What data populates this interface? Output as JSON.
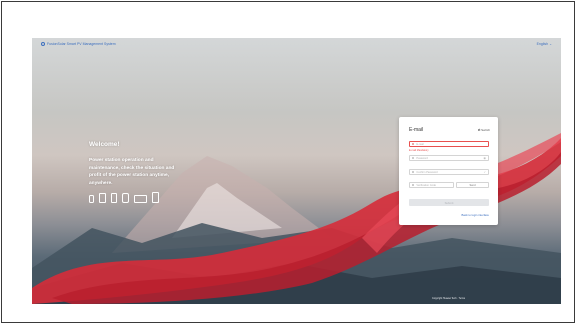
{
  "header": {
    "brand": "FusionSolar Smart PV Management System",
    "language": "English"
  },
  "hero": {
    "welcome": "Welcome!",
    "tagline": "Power station operation and maintenance, check the situation and profit of the power station anytime, anywhere."
  },
  "devices": [
    "mobile-icon",
    "tablet-icon",
    "phone-icon",
    "watch-icon",
    "laptop-icon",
    "tablet-alt-icon"
  ],
  "login": {
    "title": "E-mail",
    "switch_label": "⇄ Switch",
    "email_placeholder": "E-mail",
    "email_error": "E-mail Mandatory",
    "password_placeholder": "Password",
    "confirm_placeholder": "Confirm Password",
    "code_placeholder": "Verification Code",
    "code_button": "Send",
    "submit": "Submit",
    "back_link": "Back to login interface"
  },
  "footer": {
    "copyright": "Copyright Huawei Tech · Terms"
  },
  "colors": {
    "accent": "#3c6fbf",
    "error": "#e8504f",
    "ribbon": "#d62c3a"
  }
}
